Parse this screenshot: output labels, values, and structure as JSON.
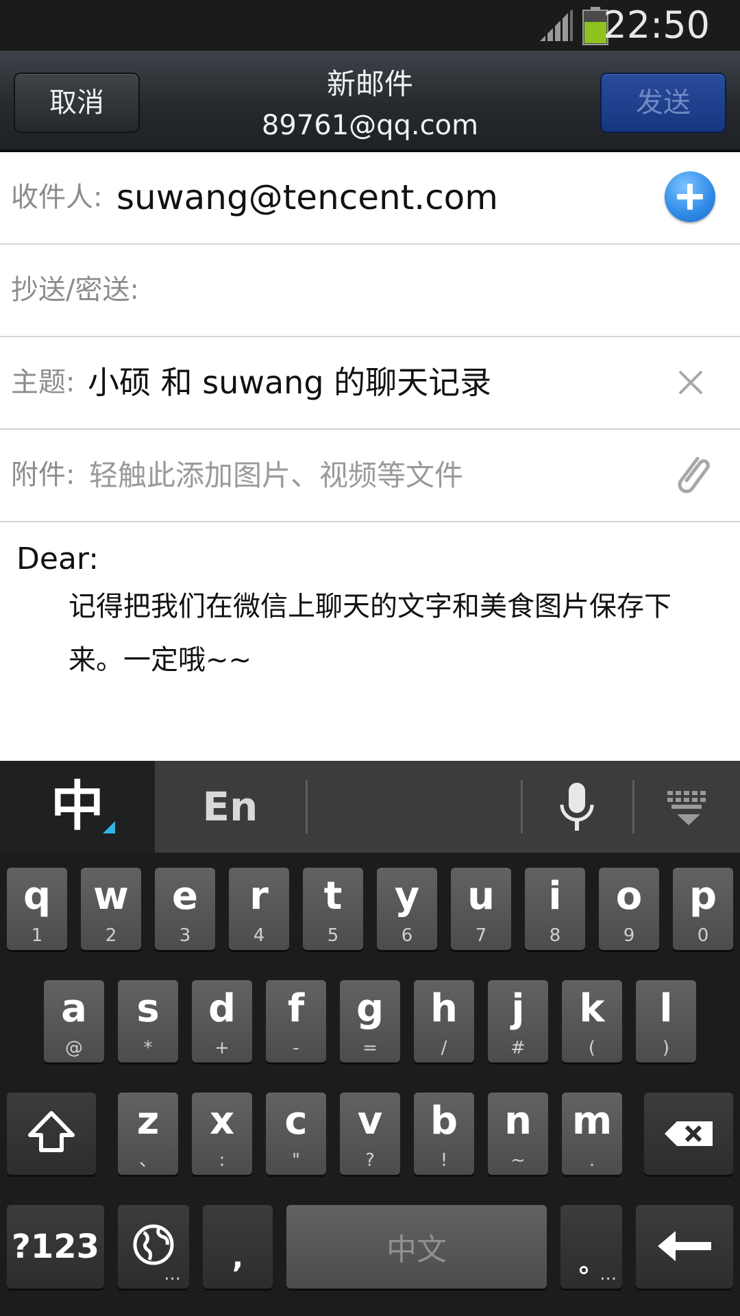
{
  "status_bar": {
    "time": "22:50"
  },
  "header": {
    "cancel_label": "取消",
    "title": "新邮件",
    "account": "89761@qq.com",
    "send_label": "发送"
  },
  "form": {
    "to_label": "收件人:",
    "to_value": "suwang@tencent.com",
    "cc_label": "抄送/密送:",
    "subject_label": "主题:",
    "subject_value": "小硕 和 suwang 的聊天记录",
    "attach_label": "附件:",
    "attach_placeholder": "轻触此添加图片、视频等文件"
  },
  "body": {
    "greeting": "Dear:",
    "text": "记得把我们在微信上聊天的文字和美食图片保存下来。一定哦~~"
  },
  "keyboard": {
    "tab_zh": "中",
    "tab_en": "En",
    "row1": [
      {
        "main": "q",
        "sub": "1"
      },
      {
        "main": "w",
        "sub": "2"
      },
      {
        "main": "e",
        "sub": "3"
      },
      {
        "main": "r",
        "sub": "4"
      },
      {
        "main": "t",
        "sub": "5"
      },
      {
        "main": "y",
        "sub": "6"
      },
      {
        "main": "u",
        "sub": "7"
      },
      {
        "main": "i",
        "sub": "8"
      },
      {
        "main": "o",
        "sub": "9"
      },
      {
        "main": "p",
        "sub": "0"
      }
    ],
    "row2": [
      {
        "main": "a",
        "sub": "@"
      },
      {
        "main": "s",
        "sub": "*"
      },
      {
        "main": "d",
        "sub": "+"
      },
      {
        "main": "f",
        "sub": "-"
      },
      {
        "main": "g",
        "sub": "="
      },
      {
        "main": "h",
        "sub": "/"
      },
      {
        "main": "j",
        "sub": "#"
      },
      {
        "main": "k",
        "sub": "("
      },
      {
        "main": "l",
        "sub": ")"
      }
    ],
    "row3": [
      {
        "main": "z",
        "sub": "、"
      },
      {
        "main": "x",
        "sub": ":"
      },
      {
        "main": "c",
        "sub": "\""
      },
      {
        "main": "v",
        "sub": "?"
      },
      {
        "main": "b",
        "sub": "!"
      },
      {
        "main": "n",
        "sub": "~"
      },
      {
        "main": "m",
        "sub": "."
      }
    ],
    "symbols_label": "?123",
    "globe_sub": "...",
    "comma_label": ",",
    "space_label": "中文",
    "period_label": "。",
    "period_sub": "..."
  },
  "colors": {
    "accent_blue": "#2f8ae6",
    "send_button": "#1a3c8c",
    "keyboard_bg": "#1a1c1e"
  }
}
